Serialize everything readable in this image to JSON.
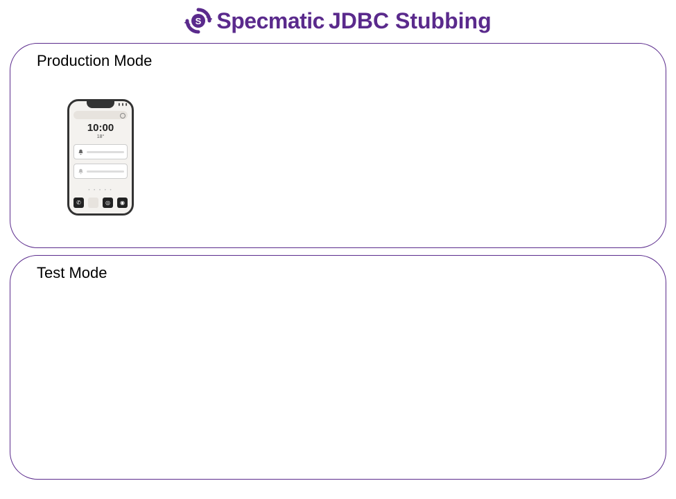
{
  "header": {
    "brand": "Specmatic",
    "title_rest": " JDBC Stubbing"
  },
  "panels": {
    "production": {
      "title": "Production Mode"
    },
    "test": {
      "title": "Test Mode"
    }
  },
  "phone": {
    "time": "10:00",
    "temp": "18°",
    "status": "▮ ▮ ▮",
    "dots": "• • • • •",
    "dock": {
      "phone": "✆",
      "blank": " ",
      "chat": "◎",
      "camera": "◉"
    }
  }
}
